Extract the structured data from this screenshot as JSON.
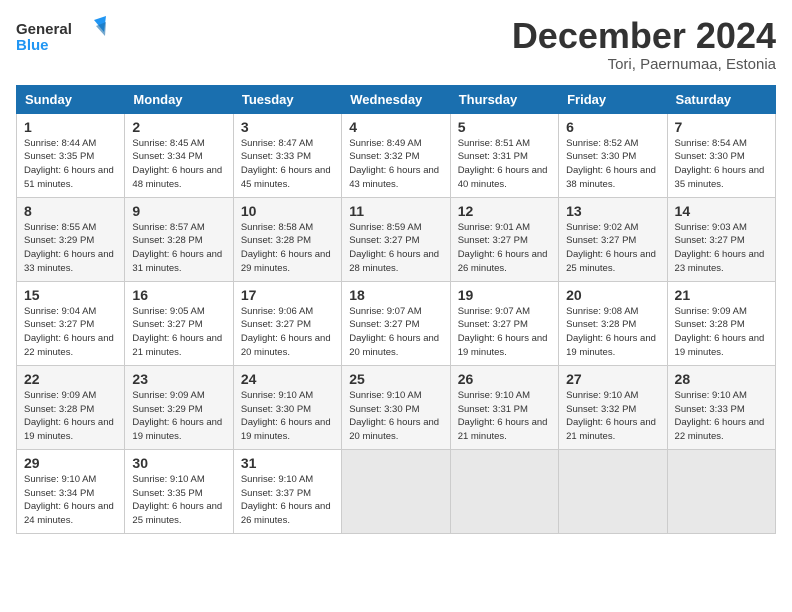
{
  "header": {
    "logo_line1": "General",
    "logo_line2": "Blue",
    "month": "December 2024",
    "location": "Tori, Paernumaa, Estonia"
  },
  "days_of_week": [
    "Sunday",
    "Monday",
    "Tuesday",
    "Wednesday",
    "Thursday",
    "Friday",
    "Saturday"
  ],
  "weeks": [
    [
      {
        "day": 1,
        "sunrise": "8:44 AM",
        "sunset": "3:35 PM",
        "daylight": "6 hours and 51 minutes."
      },
      {
        "day": 2,
        "sunrise": "8:45 AM",
        "sunset": "3:34 PM",
        "daylight": "6 hours and 48 minutes."
      },
      {
        "day": 3,
        "sunrise": "8:47 AM",
        "sunset": "3:33 PM",
        "daylight": "6 hours and 45 minutes."
      },
      {
        "day": 4,
        "sunrise": "8:49 AM",
        "sunset": "3:32 PM",
        "daylight": "6 hours and 43 minutes."
      },
      {
        "day": 5,
        "sunrise": "8:51 AM",
        "sunset": "3:31 PM",
        "daylight": "6 hours and 40 minutes."
      },
      {
        "day": 6,
        "sunrise": "8:52 AM",
        "sunset": "3:30 PM",
        "daylight": "6 hours and 38 minutes."
      },
      {
        "day": 7,
        "sunrise": "8:54 AM",
        "sunset": "3:30 PM",
        "daylight": "6 hours and 35 minutes."
      }
    ],
    [
      {
        "day": 8,
        "sunrise": "8:55 AM",
        "sunset": "3:29 PM",
        "daylight": "6 hours and 33 minutes."
      },
      {
        "day": 9,
        "sunrise": "8:57 AM",
        "sunset": "3:28 PM",
        "daylight": "6 hours and 31 minutes."
      },
      {
        "day": 10,
        "sunrise": "8:58 AM",
        "sunset": "3:28 PM",
        "daylight": "6 hours and 29 minutes."
      },
      {
        "day": 11,
        "sunrise": "8:59 AM",
        "sunset": "3:27 PM",
        "daylight": "6 hours and 28 minutes."
      },
      {
        "day": 12,
        "sunrise": "9:01 AM",
        "sunset": "3:27 PM",
        "daylight": "6 hours and 26 minutes."
      },
      {
        "day": 13,
        "sunrise": "9:02 AM",
        "sunset": "3:27 PM",
        "daylight": "6 hours and 25 minutes."
      },
      {
        "day": 14,
        "sunrise": "9:03 AM",
        "sunset": "3:27 PM",
        "daylight": "6 hours and 23 minutes."
      }
    ],
    [
      {
        "day": 15,
        "sunrise": "9:04 AM",
        "sunset": "3:27 PM",
        "daylight": "6 hours and 22 minutes."
      },
      {
        "day": 16,
        "sunrise": "9:05 AM",
        "sunset": "3:27 PM",
        "daylight": "6 hours and 21 minutes."
      },
      {
        "day": 17,
        "sunrise": "9:06 AM",
        "sunset": "3:27 PM",
        "daylight": "6 hours and 20 minutes."
      },
      {
        "day": 18,
        "sunrise": "9:07 AM",
        "sunset": "3:27 PM",
        "daylight": "6 hours and 20 minutes."
      },
      {
        "day": 19,
        "sunrise": "9:07 AM",
        "sunset": "3:27 PM",
        "daylight": "6 hours and 19 minutes."
      },
      {
        "day": 20,
        "sunrise": "9:08 AM",
        "sunset": "3:28 PM",
        "daylight": "6 hours and 19 minutes."
      },
      {
        "day": 21,
        "sunrise": "9:09 AM",
        "sunset": "3:28 PM",
        "daylight": "6 hours and 19 minutes."
      }
    ],
    [
      {
        "day": 22,
        "sunrise": "9:09 AM",
        "sunset": "3:28 PM",
        "daylight": "6 hours and 19 minutes."
      },
      {
        "day": 23,
        "sunrise": "9:09 AM",
        "sunset": "3:29 PM",
        "daylight": "6 hours and 19 minutes."
      },
      {
        "day": 24,
        "sunrise": "9:10 AM",
        "sunset": "3:30 PM",
        "daylight": "6 hours and 19 minutes."
      },
      {
        "day": 25,
        "sunrise": "9:10 AM",
        "sunset": "3:30 PM",
        "daylight": "6 hours and 20 minutes."
      },
      {
        "day": 26,
        "sunrise": "9:10 AM",
        "sunset": "3:31 PM",
        "daylight": "6 hours and 21 minutes."
      },
      {
        "day": 27,
        "sunrise": "9:10 AM",
        "sunset": "3:32 PM",
        "daylight": "6 hours and 21 minutes."
      },
      {
        "day": 28,
        "sunrise": "9:10 AM",
        "sunset": "3:33 PM",
        "daylight": "6 hours and 22 minutes."
      }
    ],
    [
      {
        "day": 29,
        "sunrise": "9:10 AM",
        "sunset": "3:34 PM",
        "daylight": "6 hours and 24 minutes."
      },
      {
        "day": 30,
        "sunrise": "9:10 AM",
        "sunset": "3:35 PM",
        "daylight": "6 hours and 25 minutes."
      },
      {
        "day": 31,
        "sunrise": "9:10 AM",
        "sunset": "3:37 PM",
        "daylight": "6 hours and 26 minutes."
      },
      null,
      null,
      null,
      null
    ]
  ]
}
